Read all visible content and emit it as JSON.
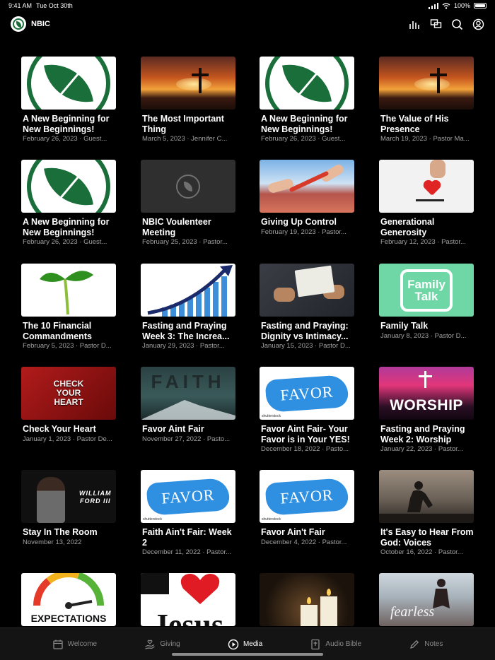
{
  "status_bar": {
    "time": "9:41 AM",
    "date": "Tue Oct 30th",
    "battery": "100%"
  },
  "header": {
    "title": "NBIC",
    "icons": [
      "equalizer-icon",
      "chat-icon",
      "search-icon",
      "account-icon"
    ]
  },
  "media": [
    {
      "title": "A New Beginning for New Beginnings!",
      "meta": "February 26, 2023 · Guest..."
    },
    {
      "title": "The Most Important Thing",
      "meta": "March 5, 2023 · Jennifer C..."
    },
    {
      "title": "A New Beginning for New Beginnings!",
      "meta": "February 26, 2023 · Guest..."
    },
    {
      "title": "The Value of His Presence",
      "meta": "March 19, 2023 · Pastor Ma..."
    },
    {
      "title": "A New Beginning for New Beginnings!",
      "meta": "February 26, 2023 · Guest..."
    },
    {
      "title": "NBIC Voulenteer Meeting",
      "meta": "February 25, 2023 · Pastor..."
    },
    {
      "title": "Giving Up Control",
      "meta": "February 19, 2023 · Pastor..."
    },
    {
      "title": "Generational Generosity",
      "meta": "February 12, 2023 · Pastor..."
    },
    {
      "title": "The 10 Financial Commandments",
      "meta": "February 5, 2023 · Pastor D..."
    },
    {
      "title": "Fasting and Praying Week 3: The Increa...",
      "meta": "January 29, 2023 · Pastor..."
    },
    {
      "title": "Fasting and Praying: Dignity vs Intimacy...",
      "meta": "January 15, 2023 · Pastor D..."
    },
    {
      "title": "Family Talk",
      "meta": "January 8, 2023 · Pastor D..."
    },
    {
      "title": "Check Your Heart",
      "meta": "January 1, 2023 · Pastor De..."
    },
    {
      "title": "Favor Aint Fair",
      "meta": "November 27, 2022 · Pasto..."
    },
    {
      "title": "Favor Aint Fair- Your Favor is in Your YES!",
      "meta": "December 18, 2022 · Pasto..."
    },
    {
      "title": "Fasting and Praying Week 2: Worship",
      "meta": "January 22, 2023 · Pastor..."
    },
    {
      "title": "Stay In The Room",
      "meta": "November 13, 2022"
    },
    {
      "title": "Faith Ain't Fair: Week 2",
      "meta": "December 11, 2022 · Pastor..."
    },
    {
      "title": "Favor Ain't Fair",
      "meta": "December 4, 2022 · Pastor..."
    },
    {
      "title": "It's Easy to Hear From God: Voices",
      "meta": "October 16, 2022 · Pastor..."
    },
    {
      "title": "",
      "meta": ""
    },
    {
      "title": "",
      "meta": ""
    },
    {
      "title": "",
      "meta": ""
    },
    {
      "title": "",
      "meta": ""
    }
  ],
  "thumb_text": {
    "family": [
      "Family",
      "Talk"
    ],
    "check_heart": [
      "CHECK",
      "YOUR",
      "HEART"
    ],
    "faith": "FAITH",
    "favor": "FAVOR",
    "worship": "WORSHIP",
    "speaker": [
      "WILLIAM",
      "FORD III"
    ],
    "expectations": "EXPECTATIONS",
    "jesus": "Jesus",
    "fearless": "fearless",
    "shutterstock": "shutterstock"
  },
  "tabs": [
    {
      "label": "Welcome",
      "icon": "calendar-icon",
      "active": false
    },
    {
      "label": "Giving",
      "icon": "hand-heart-icon",
      "active": false
    },
    {
      "label": "Media",
      "icon": "play-circle-icon",
      "active": true
    },
    {
      "label": "Audio Bible",
      "icon": "bible-icon",
      "active": false
    },
    {
      "label": "Notes",
      "icon": "pencil-icon",
      "active": false
    }
  ],
  "colors": {
    "accent_green": "#1a6e3a",
    "background": "#000000",
    "tab_bar": "#141414",
    "meta_text": "#a0a0a0"
  }
}
